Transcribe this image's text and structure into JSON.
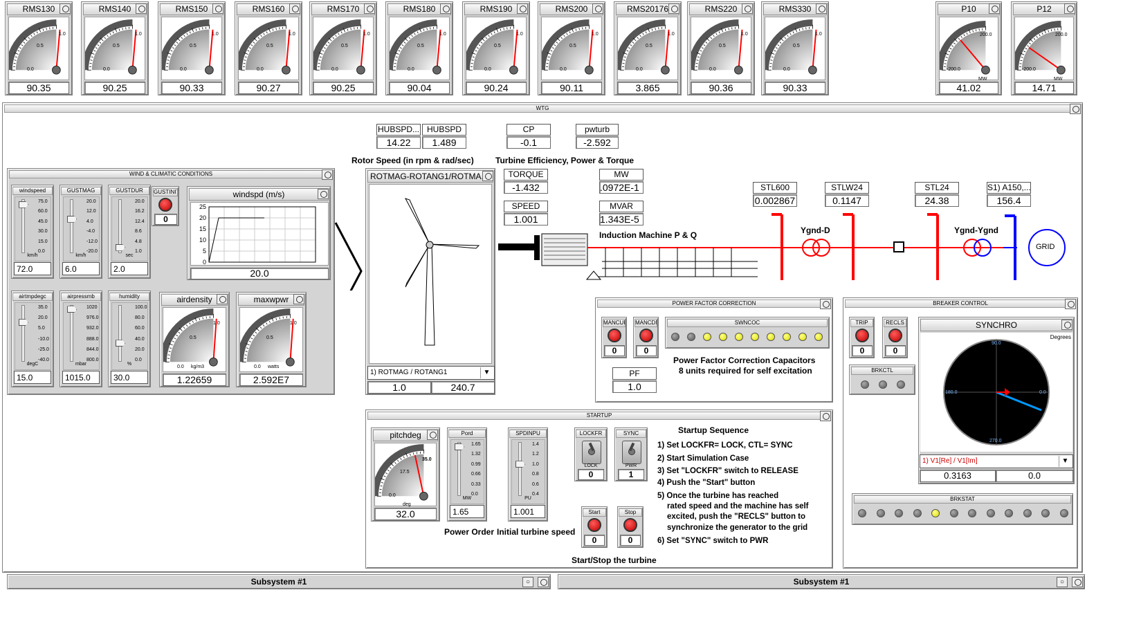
{
  "top_meters": [
    {
      "name": "RMS130",
      "value": "90.35",
      "lo": "0.0",
      "mid": "0.5",
      "hi": "1.0"
    },
    {
      "name": "RMS140",
      "value": "90.25",
      "lo": "0.0",
      "mid": "0.5",
      "hi": "1.0"
    },
    {
      "name": "RMS150",
      "value": "90.33",
      "lo": "0.0",
      "mid": "0.5",
      "hi": "1.0"
    },
    {
      "name": "RMS160",
      "value": "90.27",
      "lo": "0.0",
      "mid": "0.5",
      "hi": "1.0"
    },
    {
      "name": "RMS170",
      "value": "90.25",
      "lo": "0.0",
      "mid": "0.5",
      "hi": "1.0"
    },
    {
      "name": "RMS180",
      "value": "90.04",
      "lo": "0.0",
      "mid": "0.5",
      "hi": "1.0"
    },
    {
      "name": "RMS190",
      "value": "90.24",
      "lo": "0.0",
      "mid": "0.5",
      "hi": "1.0"
    },
    {
      "name": "RMS200",
      "value": "90.11",
      "lo": "0.0",
      "mid": "0.5",
      "hi": "1.0"
    },
    {
      "name": "RMS20176",
      "value": "3.865",
      "lo": "0.0",
      "mid": "0.5",
      "hi": "1.0"
    },
    {
      "name": "RMS220",
      "value": "90.36",
      "lo": "0.0",
      "mid": "0.5",
      "hi": "1.0"
    },
    {
      "name": "RMS330",
      "value": "90.33",
      "lo": "0.0",
      "mid": "0.5",
      "hi": "1.0"
    }
  ],
  "power_meters": [
    {
      "name": "P10",
      "value": "41.02",
      "lo": "-200.0",
      "hi": "200.0",
      "unit": "MW"
    },
    {
      "name": "P12",
      "value": "14.71",
      "lo": "-200.0",
      "hi": "200.0",
      "unit": "MW"
    }
  ],
  "wtg": {
    "title": "WTG",
    "rotor_label": "Rotor Speed (in rpm & rad/sec)",
    "eff_label": "Turbine Efficiency, Power & Torque",
    "induction_label": "Induction Machine P & Q",
    "hub": [
      {
        "name": "HUBSPD...",
        "value": "14.22"
      },
      {
        "name": "HUBSPD",
        "value": "1.489"
      }
    ],
    "cp": {
      "name": "CP",
      "value": "-0.1"
    },
    "pwturb": {
      "name": "pwturb",
      "value": "-2.592"
    },
    "torque": {
      "name": "TORQUE",
      "value": "-1.432"
    },
    "speed": {
      "name": "SPEED",
      "value": "1.001"
    },
    "mw": {
      "name": "MW",
      "value": ".0972E-1"
    },
    "mvar": {
      "name": "MVAR",
      "value": "1.343E-5"
    },
    "stl": [
      {
        "name": "STL600",
        "value": "0.002867"
      },
      {
        "name": "STLW24",
        "value": "0.1147"
      },
      {
        "name": "STL24",
        "value": "24.38"
      },
      {
        "name": "S1) A150,...",
        "value": "156.4"
      }
    ],
    "tx1": "Ygnd-D",
    "tx2": "Ygnd-Ygnd",
    "grid": "GRID"
  },
  "wind_panel": {
    "title": "WIND & CLIMATIC CONDITIONS",
    "sliders_top": [
      {
        "name": "windspeed",
        "unit": "km/h",
        "value": "72.0",
        "ticks": [
          "75.0",
          "60.0",
          "45.0",
          "30.0",
          "15.0",
          "0.0"
        ]
      },
      {
        "name": "GUSTMAG",
        "unit": "km/h",
        "value": "6.0",
        "ticks": [
          "20.0",
          "12.0",
          "4.0",
          "-4.0",
          "-12.0",
          "-20.0"
        ]
      },
      {
        "name": "GUSTDUR",
        "unit": "sec",
        "value": "2.0",
        "ticks": [
          "20.0",
          "16.2",
          "12.4",
          "8.6",
          "4.8",
          "1.0"
        ]
      }
    ],
    "gustinit": {
      "name": "GUSTINIT",
      "value": "0"
    },
    "plot": {
      "title": "windspd (m/s)",
      "value": "20.0",
      "yticks": [
        "25",
        "20",
        "15",
        "10",
        "5",
        "0"
      ]
    },
    "sliders_bottom": [
      {
        "name": "airtmpdegc",
        "unit": "degC",
        "value": "15.0",
        "ticks": [
          "35.0",
          "20.0",
          "5.0",
          "-10.0",
          "-25.0",
          "-40.0"
        ]
      },
      {
        "name": "airpressmb",
        "unit": "mbar",
        "value": "1015.0",
        "ticks": [
          "1020",
          "976.0",
          "932.0",
          "888.0",
          "844.0",
          "800.0"
        ]
      },
      {
        "name": "humidity",
        "unit": "%",
        "value": "30.0",
        "ticks": [
          "100.0",
          "80.0",
          "60.0",
          "40.0",
          "20.0",
          "0.0"
        ]
      }
    ],
    "airdensity": {
      "name": "airdensity",
      "unit": "kg/m3",
      "value": "1.22659",
      "lo": "0.0",
      "mid": "0.5",
      "hi": "1.0"
    },
    "maxwpwr": {
      "name": "maxwpwr",
      "unit": "watts",
      "value": "2.592E7",
      "lo": "0.0",
      "mid": "0.5",
      "hi": "1.0"
    }
  },
  "rotor_panel": {
    "title": "ROTMAG-ROTANG1/ROTMA...",
    "select": "1) ROTMAG / ROTANG1",
    "v1": "1.0",
    "v2": "240.7"
  },
  "pfc": {
    "title": "POWER FACTOR CORRECTION",
    "mancup": {
      "name": "MANCUP",
      "value": "0"
    },
    "mancdn": {
      "name": "MANCDN",
      "value": "0"
    },
    "sw_title": "SWNCOC",
    "desc1": "Power Factor Correction Capacitors",
    "desc2": "8 units required for self excitation",
    "pf": {
      "name": "PF",
      "value": "1.0"
    }
  },
  "breaker": {
    "title": "BREAKER CONTROL",
    "trip": {
      "name": "TRIP",
      "value": "0"
    },
    "recls": {
      "name": "RECLS",
      "value": "0"
    },
    "brkctl": "BRKCTL",
    "synchro": {
      "title": "SYNCHRO",
      "unit": "Degrees",
      "t90": "90.0",
      "t180": "180.0",
      "t0": "0.0",
      "t270": "270.0",
      "select": "1) V1[Re] / V1[Im]",
      "v1": "0.3163",
      "v2": "0.0"
    },
    "brkstat": "BRKSTAT"
  },
  "startup": {
    "title": "STARTUP",
    "pitch": {
      "name": "pitchdeg",
      "unit": "deg",
      "value": "32.0",
      "lo": "0.0",
      "mid": "17.5",
      "hi": "35.0"
    },
    "pord": {
      "name": "Pord",
      "unit": "MW",
      "value": "1.65",
      "ticks": [
        "1.65",
        "1.32",
        "0.99",
        "0.66",
        "0.33",
        "0.0"
      ]
    },
    "spdinpu": {
      "name": "SPDINPU",
      "unit": "PU",
      "value": "1.001",
      "ticks": [
        "1.4",
        "1.2",
        "1.0",
        "0.8",
        "0.6",
        "0.4"
      ]
    },
    "lockfr": {
      "name": "LOCKFR",
      "pos": "LOCK",
      "value": "0"
    },
    "sync": {
      "name": "SYNC",
      "pos": "PWR",
      "value": "1"
    },
    "start": {
      "name": "Start",
      "value": "0"
    },
    "stop": {
      "name": "Stop",
      "value": "0"
    },
    "power_order": "Power Order",
    "init_speed": "Initial turbine speed",
    "startstop": "Start/Stop the turbine",
    "seq_title": "Startup Sequence",
    "steps": [
      "1) Set LOCKFR= LOCK, CTL= SYNC",
      "2) Start Simulation Case",
      "3) Set \"LOCKFR\" switch to RELEASE",
      "4) Push the \"Start\" button",
      "5) Once the turbine has reached",
      "rated speed and the machine has self",
      "excited, push the \"RECLS\" button to",
      "synchronize the generator to the grid",
      "6) Set \"SYNC\" switch to PWR"
    ]
  },
  "bottom": [
    {
      "title": "Subsystem #1"
    },
    {
      "title": "Subsystem #1"
    }
  ]
}
